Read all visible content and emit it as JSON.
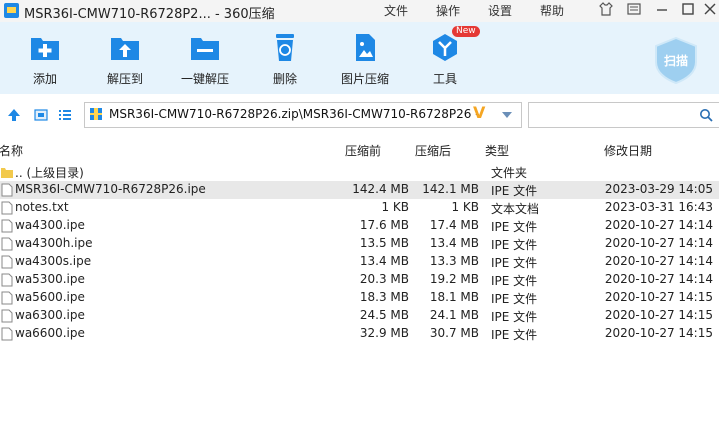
{
  "window": {
    "title": "MSR36I-CMW710-R6728P2... - 360压缩",
    "menu": [
      "文件",
      "操作",
      "设置",
      "帮助"
    ]
  },
  "toolbar": {
    "add": "添加",
    "extract_to": "解压到",
    "one_click_extract": "一键解压",
    "delete": "删除",
    "image_compress": "图片压缩",
    "tools": "工具",
    "tools_badge": "New",
    "scan": "扫描"
  },
  "address": {
    "path": "MSR36I-CMW710-R6728P26.zip\\MSR36I-CMW710-R6728P26 -",
    "search_placeholder": ""
  },
  "columns": {
    "name": "名称",
    "compressed": "压缩前",
    "original": "压缩后",
    "type": "类型",
    "modified": "修改日期"
  },
  "files": [
    {
      "name": ".. (上级目录)",
      "compressed": "",
      "original": "",
      "type": "文件夹",
      "modified": "",
      "icon": "folder-icon",
      "selected": false
    },
    {
      "name": "MSR36I-CMW710-R6728P26.ipe",
      "compressed": "142.4 MB",
      "original": "142.1 MB",
      "type": "IPE 文件",
      "modified": "2023-03-29 14:05",
      "icon": "file-icon",
      "selected": true
    },
    {
      "name": "notes.txt",
      "compressed": "1 KB",
      "original": "1 KB",
      "type": "文本文档",
      "modified": "2023-03-31 16:43",
      "icon": "file-icon",
      "selected": false
    },
    {
      "name": "wa4300.ipe",
      "compressed": "17.6 MB",
      "original": "17.4 MB",
      "type": "IPE 文件",
      "modified": "2020-10-27 14:14",
      "icon": "file-icon",
      "selected": false
    },
    {
      "name": "wa4300h.ipe",
      "compressed": "13.5 MB",
      "original": "13.4 MB",
      "type": "IPE 文件",
      "modified": "2020-10-27 14:14",
      "icon": "file-icon",
      "selected": false
    },
    {
      "name": "wa4300s.ipe",
      "compressed": "13.4 MB",
      "original": "13.3 MB",
      "type": "IPE 文件",
      "modified": "2020-10-27 14:14",
      "icon": "file-icon",
      "selected": false
    },
    {
      "name": "wa5300.ipe",
      "compressed": "20.3 MB",
      "original": "19.2 MB",
      "type": "IPE 文件",
      "modified": "2020-10-27 14:14",
      "icon": "file-icon",
      "selected": false
    },
    {
      "name": "wa5600.ipe",
      "compressed": "18.3 MB",
      "original": "18.1 MB",
      "type": "IPE 文件",
      "modified": "2020-10-27 14:15",
      "icon": "file-icon",
      "selected": false
    },
    {
      "name": "wa6300.ipe",
      "compressed": "24.5 MB",
      "original": "24.1 MB",
      "type": "IPE 文件",
      "modified": "2020-10-27 14:15",
      "icon": "file-icon",
      "selected": false
    },
    {
      "name": "wa6600.ipe",
      "compressed": "32.9 MB",
      "original": "30.7 MB",
      "type": "IPE 文件",
      "modified": "2020-10-27 14:15",
      "icon": "file-icon",
      "selected": false
    }
  ],
  "colors": {
    "toolbar_bg": "#e6f3fc",
    "accent": "#1e88e5",
    "selected_row": "#e8e8e8"
  }
}
